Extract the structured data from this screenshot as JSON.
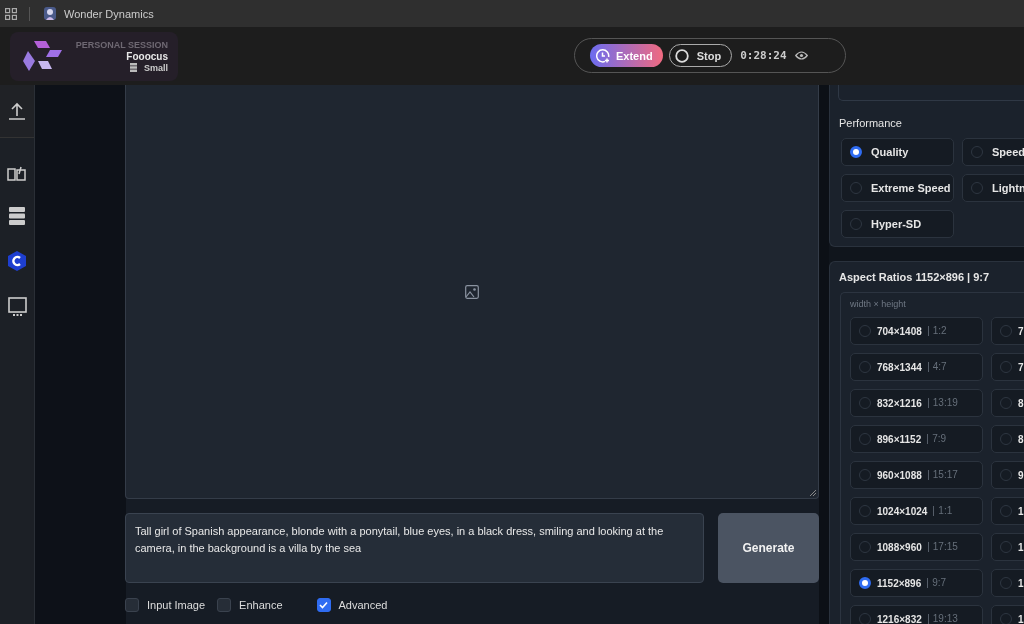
{
  "titlebar": {
    "app_name": "Wonder Dynamics"
  },
  "session": {
    "label": "PERSONAL SESSION",
    "name": "Fooocus",
    "size": "Small"
  },
  "controls": {
    "extend": "Extend",
    "stop": "Stop",
    "timer": "0:28:24"
  },
  "prompt": {
    "value": "Tall girl of Spanish appearance, blonde with a ponytail, blue eyes, in a black dress, smiling and looking at the camera, in the background is a villa by the sea"
  },
  "generate": "Generate",
  "options": [
    {
      "label": "Input Image",
      "checked": false
    },
    {
      "label": "Enhance",
      "checked": false
    },
    {
      "label": "Advanced",
      "checked": true
    }
  ],
  "performance": {
    "title": "Performance",
    "items": [
      {
        "label": "Quality",
        "selected": true
      },
      {
        "label": "Speed",
        "selected": false
      },
      {
        "label": "Extreme Speed",
        "selected": false
      },
      {
        "label": "Lightn",
        "selected": false
      },
      {
        "label": "Hyper-SD",
        "selected": false
      }
    ]
  },
  "aspect_ratios": {
    "title": "Aspect Ratios 1152×896 | 9:7",
    "hint": "width × height",
    "items": [
      {
        "size": "704×1408",
        "ratio": "1:2",
        "selected": false
      },
      {
        "size": "7",
        "selected": false
      },
      {
        "size": "768×1344",
        "ratio": "4:7",
        "selected": false
      },
      {
        "size": "7",
        "selected": false
      },
      {
        "size": "832×1216",
        "ratio": "13:19",
        "selected": false
      },
      {
        "size": "8",
        "selected": false
      },
      {
        "size": "896×1152",
        "ratio": "7:9",
        "selected": false
      },
      {
        "size": "8",
        "selected": false
      },
      {
        "size": "960×1088",
        "ratio": "15:17",
        "selected": false
      },
      {
        "size": "9",
        "selected": false
      },
      {
        "size": "1024×1024",
        "ratio": "1:1",
        "selected": false
      },
      {
        "size": "1",
        "selected": false
      },
      {
        "size": "1088×960",
        "ratio": "17:15",
        "selected": false
      },
      {
        "size": "1",
        "selected": false
      },
      {
        "size": "1152×896",
        "ratio": "9:7",
        "selected": true
      },
      {
        "size": "1",
        "selected": false
      },
      {
        "size": "1216×832",
        "ratio": "19:13",
        "selected": false
      },
      {
        "size": "1",
        "selected": false
      }
    ]
  }
}
